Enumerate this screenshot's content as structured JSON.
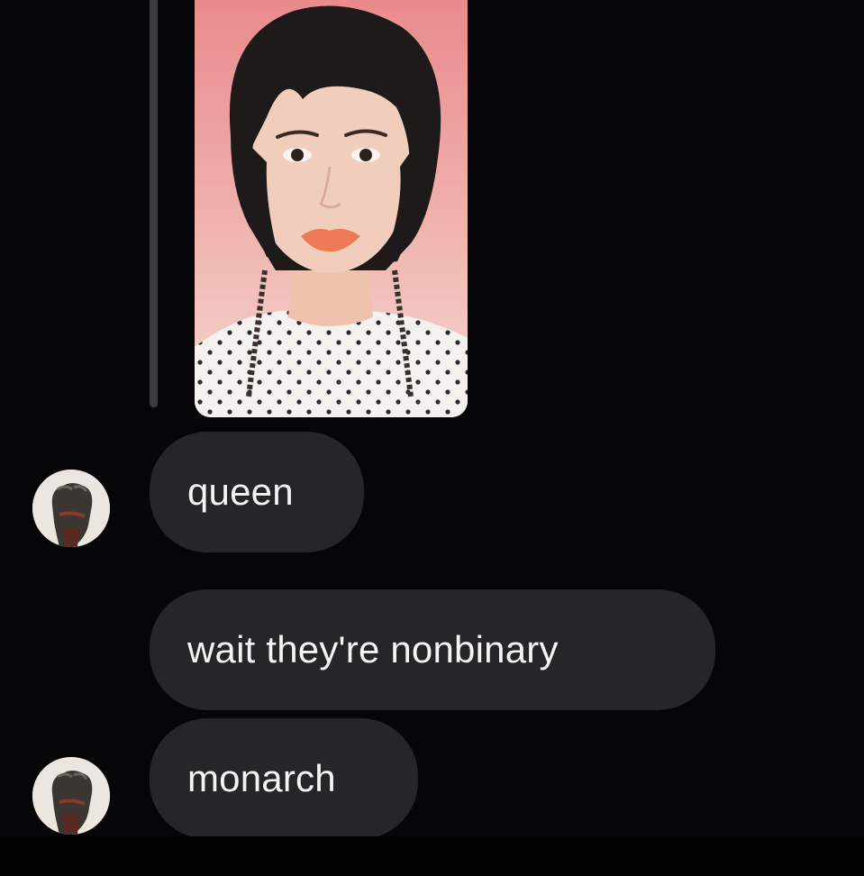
{
  "chat": {
    "reply_thread": {
      "photo_icon": "portrait-photo"
    },
    "messages": [
      {
        "text": "queen",
        "sender_avatar": "avatar-fist-icon"
      },
      {
        "text": "wait they're nonbinary"
      },
      {
        "text": "monarch",
        "sender_avatar": "avatar-fist-icon"
      }
    ]
  },
  "colors": {
    "background": "#060608",
    "bubble": "#262628",
    "text": "#f4f4f4"
  }
}
